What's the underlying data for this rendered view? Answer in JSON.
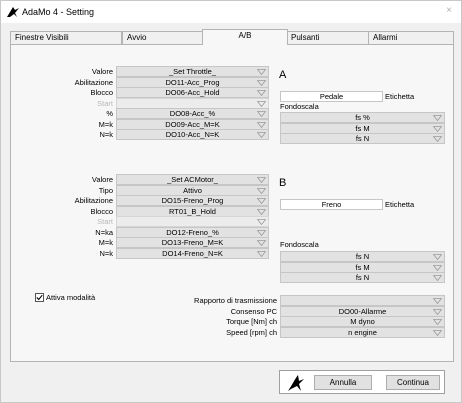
{
  "window": {
    "title": "AdaMo 4 - Setting",
    "close_glyph": "×"
  },
  "tabs": [
    {
      "label": "Finestre Visibili"
    },
    {
      "label": "Avvio"
    },
    {
      "label": "A/B"
    },
    {
      "label": "Pulsanti"
    },
    {
      "label": "Allarmi"
    }
  ],
  "section_a": {
    "letter": "A",
    "rows": [
      {
        "label": "Valore",
        "value": "_Set Throttle_",
        "disabled": false
      },
      {
        "label": "Abilitazione",
        "value": "DO11-Acc_Prog",
        "disabled": false
      },
      {
        "label": "Blocco",
        "value": "DO06-Acc_Hold",
        "disabled": false
      },
      {
        "label": "Start",
        "value": "",
        "disabled": true
      },
      {
        "label": "%",
        "value": "DO08-Acc_%",
        "disabled": false
      },
      {
        "label": "M=k",
        "value": "DO09-Acc_M=K",
        "disabled": false
      },
      {
        "label": "N=k",
        "value": "DO10-Acc_N=K",
        "disabled": false
      }
    ],
    "name_value": "Pedale",
    "name_label": "Etichetta",
    "fondoscala_label": "Fondoscala",
    "fondoscala": [
      "fs %",
      "fs M",
      "fs N"
    ]
  },
  "section_b": {
    "letter": "B",
    "rows": [
      {
        "label": "Valore",
        "value": "_Set ACMotor_",
        "disabled": false
      },
      {
        "label": "Tipo",
        "value": "Attivo",
        "disabled": false
      },
      {
        "label": "Abilitazione",
        "value": "DO15-Freno_Prog",
        "disabled": false
      },
      {
        "label": "Blocco",
        "value": "RT01_B_Hold",
        "disabled": false
      },
      {
        "label": "Start",
        "value": "",
        "disabled": true
      },
      {
        "label": "N=ka",
        "value": "DO12-Freno_%",
        "disabled": false
      },
      {
        "label": "M=k",
        "value": "DO13-Freno_M=K",
        "disabled": false
      },
      {
        "label": "N=k",
        "value": "DO14-Freno_N=K",
        "disabled": false
      }
    ],
    "name_value": "Freno",
    "name_label": "Etichetta",
    "fondoscala_label": "Fondoscala",
    "fondoscala": [
      "fs N",
      "fs M",
      "fs N"
    ]
  },
  "bottom": {
    "checkbox_label": "Attiva modalità",
    "checkbox_checked": true,
    "rows": [
      {
        "label": "Rapporto di trasmissione",
        "value": ""
      },
      {
        "label": "Consenso PC",
        "value": "DO00-Allarme"
      },
      {
        "label": "Torque [Nm] ch",
        "value": "M dyno"
      },
      {
        "label": "Speed [rpm] ch",
        "value": "n engine"
      }
    ]
  },
  "buttons": {
    "cancel": "Annulla",
    "continue": "Continua"
  }
}
